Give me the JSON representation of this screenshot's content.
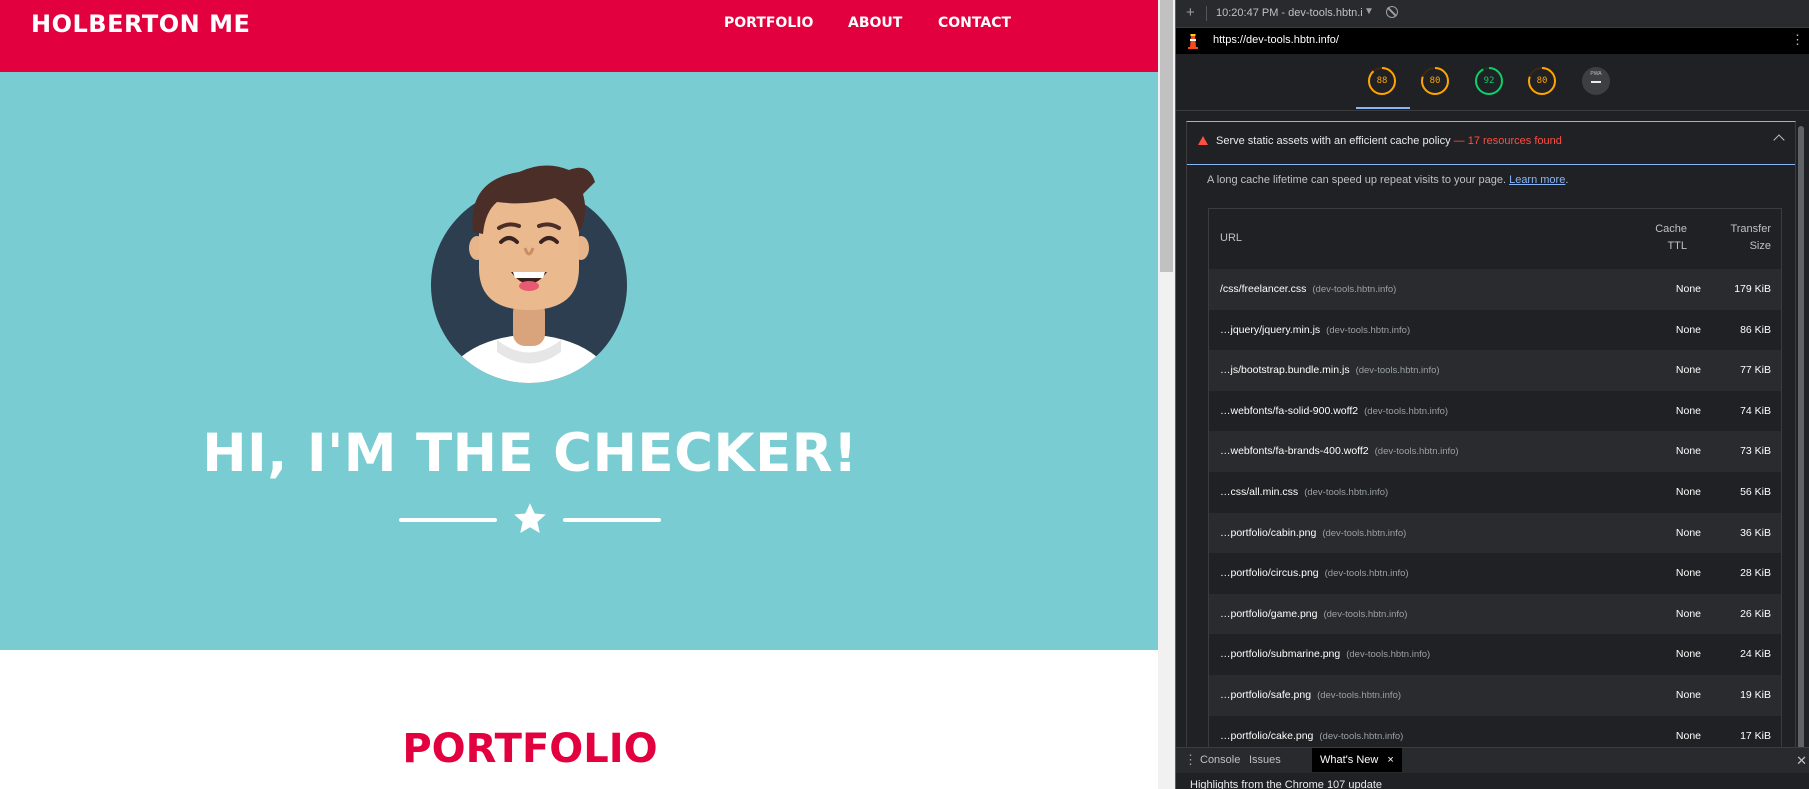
{
  "site": {
    "brand": "HOLBERTON ME",
    "nav": [
      "PORTFOLIO",
      "ABOUT",
      "CONTACT"
    ],
    "hero_title": "HI, I'M THE CHECKER!",
    "portfolio_heading": "PORTFOLIO",
    "colors": {
      "primary": "#e2003e",
      "hero_bg": "#79ccd1"
    }
  },
  "devtools": {
    "session": "10:20:47 PM - dev-tools.hbtn.i",
    "url": "https://dev-tools.hbtn.info/",
    "scores": [
      {
        "value": "88",
        "color": "#ffa400"
      },
      {
        "value": "80",
        "color": "#ffa400"
      },
      {
        "value": "92",
        "color": "#0cce6b"
      },
      {
        "value": "80",
        "color": "#ffa400"
      },
      {
        "value": "PWA",
        "color": "#9aa0a6"
      }
    ],
    "audit": {
      "title": "Serve static assets with an efficient cache policy",
      "found": "— 17 resources found",
      "description": "A long cache lifetime can speed up repeat visits to your page.",
      "learn_more": "Learn more",
      "columns": {
        "url": "URL",
        "ttl_1": "Cache",
        "ttl_2": "TTL",
        "size_1": "Transfer",
        "size_2": "Size"
      },
      "rows": [
        {
          "url": "/css/freelancer.css",
          "host": "(dev-tools.hbtn.info)",
          "ttl": "None",
          "size": "179 KiB"
        },
        {
          "url": "…jquery/jquery.min.js",
          "host": "(dev-tools.hbtn.info)",
          "ttl": "None",
          "size": "86 KiB"
        },
        {
          "url": "…js/bootstrap.bundle.min.js",
          "host": "(dev-tools.hbtn.info)",
          "ttl": "None",
          "size": "77 KiB"
        },
        {
          "url": "…webfonts/fa-solid-900.woff2",
          "host": "(dev-tools.hbtn.info)",
          "ttl": "None",
          "size": "74 KiB"
        },
        {
          "url": "…webfonts/fa-brands-400.woff2",
          "host": "(dev-tools.hbtn.info)",
          "ttl": "None",
          "size": "73 KiB"
        },
        {
          "url": "…css/all.min.css",
          "host": "(dev-tools.hbtn.info)",
          "ttl": "None",
          "size": "56 KiB"
        },
        {
          "url": "…portfolio/cabin.png",
          "host": "(dev-tools.hbtn.info)",
          "ttl": "None",
          "size": "36 KiB"
        },
        {
          "url": "…portfolio/circus.png",
          "host": "(dev-tools.hbtn.info)",
          "ttl": "None",
          "size": "28 KiB"
        },
        {
          "url": "…portfolio/game.png",
          "host": "(dev-tools.hbtn.info)",
          "ttl": "None",
          "size": "26 KiB"
        },
        {
          "url": "…portfolio/submarine.png",
          "host": "(dev-tools.hbtn.info)",
          "ttl": "None",
          "size": "24 KiB"
        },
        {
          "url": "…portfolio/safe.png",
          "host": "(dev-tools.hbtn.info)",
          "ttl": "None",
          "size": "19 KiB"
        },
        {
          "url": "…portfolio/cake.png",
          "host": "(dev-tools.hbtn.info)",
          "ttl": "None",
          "size": "17 KiB"
        }
      ]
    },
    "drawer": {
      "tabs": [
        "Console",
        "Issues",
        "What's New"
      ],
      "active_close": "×",
      "content": "Highlights from the Chrome 107 update"
    }
  }
}
